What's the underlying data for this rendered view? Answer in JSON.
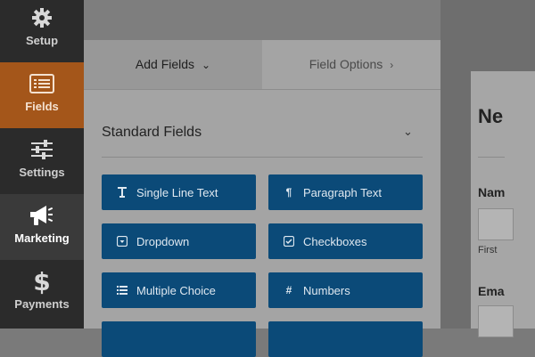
{
  "nav": {
    "items": [
      {
        "label": "Setup",
        "icon": "gear-icon"
      },
      {
        "label": "Fields",
        "icon": "fields-list-icon"
      },
      {
        "label": "Settings",
        "icon": "sliders-icon"
      },
      {
        "label": "Marketing",
        "icon": "megaphone-icon"
      },
      {
        "label": "Payments",
        "icon": "dollar-icon"
      }
    ],
    "active": "Fields",
    "colors": {
      "background": "#2b2b2b",
      "active": "#a4561a"
    }
  },
  "panel": {
    "tabs": [
      {
        "label": "Add Fields",
        "icon": "chevron-down-icon"
      },
      {
        "label": "Field Options",
        "icon": "chevron-right-icon"
      }
    ],
    "section": {
      "title": "Standard Fields",
      "icon": "chevron-down-icon"
    },
    "fields": [
      {
        "label": "Single Line Text",
        "icon": "text-cursor-icon"
      },
      {
        "label": "Paragraph Text",
        "icon": "paragraph-icon"
      },
      {
        "label": "Dropdown",
        "icon": "dropdown-icon"
      },
      {
        "label": "Checkboxes",
        "icon": "checkbox-icon"
      },
      {
        "label": "Multiple Choice",
        "icon": "list-icon"
      },
      {
        "label": "Numbers",
        "icon": "hash-icon"
      }
    ],
    "button_color": "#0b4a78"
  },
  "preview": {
    "title": "Ne",
    "name_label": "Nam",
    "first_sublabel": "First",
    "email_label": "Ema"
  }
}
